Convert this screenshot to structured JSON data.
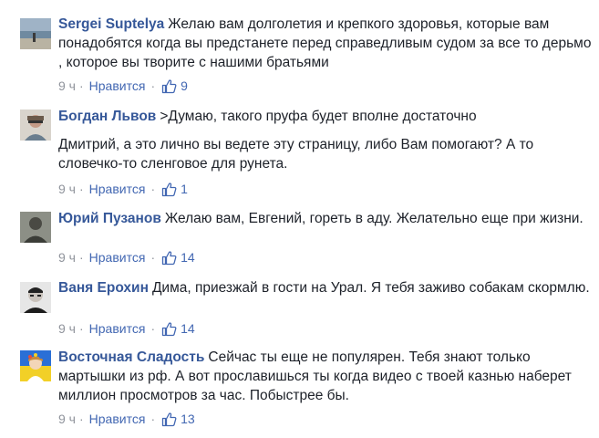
{
  "comments": [
    {
      "author": "Sergei Suptelya",
      "text": "Желаю вам долголетия и крепкого здоровья, которые вам понадобятся когда вы предстанете перед справедливым судом за все то дерьмо , которое вы творите с нашими братьями",
      "text2": "",
      "time": "9 ч",
      "like_label": "Нравится",
      "likes": "9"
    },
    {
      "author": "Богдан Львов",
      "text": ">Думаю, такого пруфа будет вполне достаточно",
      "text2": "Дмитрий, а это лично вы ведете эту страницу, либо Вам помогают? А то словечко-то сленговое для рунета.",
      "time": "9 ч",
      "like_label": "Нравится",
      "likes": "1"
    },
    {
      "author": "Юрий Пузанов",
      "text": "Желаю вам, Евгений, гореть в аду. Желательно еще при жизни.",
      "text2": "",
      "time": "9 ч",
      "like_label": "Нравится",
      "likes": "14"
    },
    {
      "author": "Ваня Ерохин",
      "text": "Дима, приезжай в гости на Урал. Я тебя заживо собакам скормлю.",
      "text2": "",
      "time": "9 ч",
      "like_label": "Нравится",
      "likes": "14"
    },
    {
      "author": "Восточная Сладость",
      "text": "Сейчас ты еще не популярен. Тебя знают только мартышки из рф. А вот прославишься ты когда видео с твоей казнью наберет миллион просмотров за час. Побыстрее бы.",
      "text2": "",
      "time": "9 ч",
      "like_label": "Нравится",
      "likes": "13"
    }
  ],
  "colors": {
    "author": "#365899",
    "like": "#4267b2",
    "meta": "#90949c",
    "text": "#1d2129"
  }
}
